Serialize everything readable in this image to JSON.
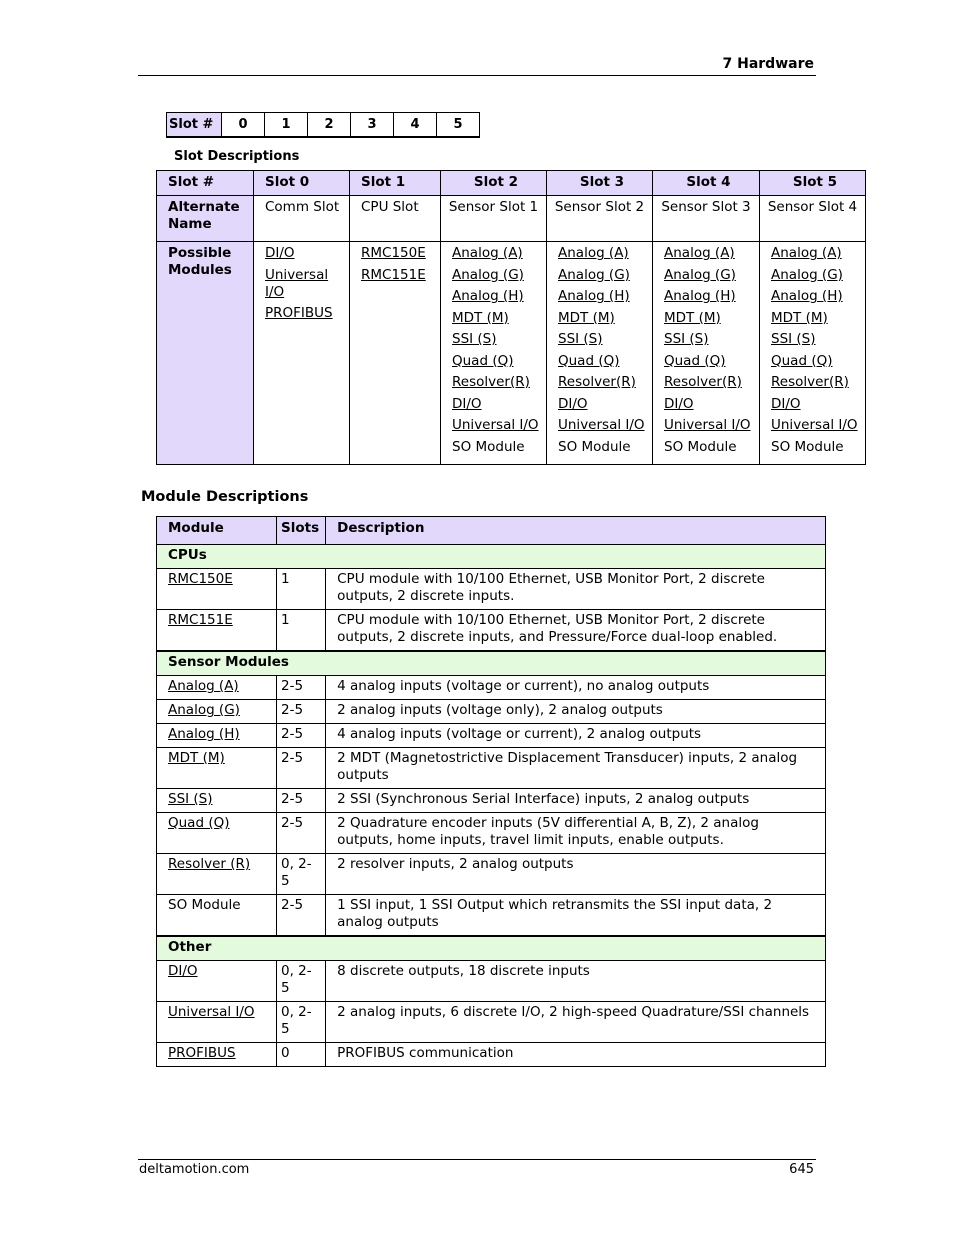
{
  "page_header": {
    "title": "7  Hardware"
  },
  "slot_strip": {
    "label": "Slot #",
    "slots": [
      "0",
      "1",
      "2",
      "3",
      "4",
      "5"
    ]
  },
  "slot_descriptions": {
    "caption": "Slot Descriptions",
    "headers": [
      "Slot #",
      "Slot 0",
      "Slot 1",
      "Slot 2",
      "Slot 3",
      "Slot 4",
      "Slot 5"
    ],
    "alternate_name": {
      "label": "Alternate Name",
      "values": [
        "Comm Slot",
        "CPU Slot",
        "Sensor Slot 1",
        "Sensor Slot 2",
        "Sensor Slot 3",
        "Sensor Slot 4"
      ]
    },
    "possible_modules": {
      "label": "Possible Modules",
      "slot0": [
        {
          "text": "DI/O",
          "link": true
        },
        {
          "text": "Universal I/O",
          "link": true
        },
        {
          "text": "PROFIBUS",
          "link": true
        }
      ],
      "slot1": [
        {
          "text": "RMC150E",
          "link": true
        },
        {
          "text": "RMC151E",
          "link": true
        }
      ],
      "sensor_slots": [
        {
          "text": "Analog (A)",
          "link": true
        },
        {
          "text": "Analog (G)",
          "link": true
        },
        {
          "text": "Analog (H)",
          "link": true
        },
        {
          "text": "MDT (M)",
          "link": true
        },
        {
          "text": "SSI (S)",
          "link": true
        },
        {
          "text": "Quad (Q)",
          "link": true
        },
        {
          "text": "Resolver(R)",
          "link": true
        },
        {
          "text": "DI/O",
          "link": true
        },
        {
          "text": "Universal I/O",
          "link": true
        },
        {
          "text": "SO Module",
          "link": false
        }
      ]
    }
  },
  "module_descriptions": {
    "title": "Module Descriptions",
    "headers": [
      "Module",
      "Slots",
      "Description"
    ],
    "groups": [
      {
        "name": "CPUs",
        "rows": [
          {
            "module": "RMC150E",
            "link": true,
            "slots": "1",
            "description": "CPU module with 10/100 Ethernet, USB Monitor Port, 2 discrete outputs, 2 discrete inputs."
          },
          {
            "module": "RMC151E",
            "link": true,
            "slots": "1",
            "description": "CPU module with 10/100 Ethernet, USB Monitor Port, 2 discrete outputs, 2 discrete inputs, and Pressure/Force dual-loop enabled."
          }
        ]
      },
      {
        "name": "Sensor Modules",
        "rows": [
          {
            "module": "Analog (A)",
            "link": true,
            "slots": "2-5",
            "description": "4 analog inputs (voltage or current), no analog outputs"
          },
          {
            "module": "Analog (G)",
            "link": true,
            "slots": "2-5",
            "description": "2 analog inputs (voltage only), 2 analog outputs"
          },
          {
            "module": "Analog (H)",
            "link": true,
            "slots": "2-5",
            "description": "4 analog inputs (voltage or current), 2 analog outputs"
          },
          {
            "module": "MDT (M)",
            "link": true,
            "slots": "2-5",
            "description": "2 MDT (Magnetostrictive Displacement Transducer) inputs, 2 analog outputs"
          },
          {
            "module": "SSI (S)",
            "link": true,
            "slots": "2-5",
            "description": "2 SSI (Synchronous Serial Interface) inputs, 2 analog outputs"
          },
          {
            "module": "Quad (Q)",
            "link": true,
            "slots": "2-5",
            "description": "2 Quadrature encoder inputs (5V differential A, B, Z), 2 analog outputs, home inputs, travel limit inputs, enable outputs."
          },
          {
            "module": "Resolver (R)",
            "link": true,
            "slots": "0, 2-5",
            "description": "2 resolver inputs, 2 analog outputs"
          },
          {
            "module": "SO Module",
            "link": false,
            "slots": "2-5",
            "description": "1 SSI input, 1 SSI Output which retransmits the SSI input data, 2 analog outputs"
          }
        ]
      },
      {
        "name": "Other",
        "rows": [
          {
            "module": "DI/O",
            "link": true,
            "slots": "0, 2-5",
            "description": "8 discrete outputs, 18 discrete inputs"
          },
          {
            "module": "Universal I/O",
            "link": true,
            "slots": "0, 2-5",
            "description": "2 analog inputs, 6 discrete I/O, 2 high-speed Quadrature/SSI channels"
          },
          {
            "module": "PROFIBUS",
            "link": true,
            "slots": "0",
            "description": "PROFIBUS communication"
          }
        ]
      }
    ]
  },
  "footer": {
    "site": "deltamotion.com",
    "page_number": "645"
  },
  "colors": {
    "header_fill": "#e2d8fc",
    "group_fill": "#e4fadc",
    "rule": "#000000"
  }
}
